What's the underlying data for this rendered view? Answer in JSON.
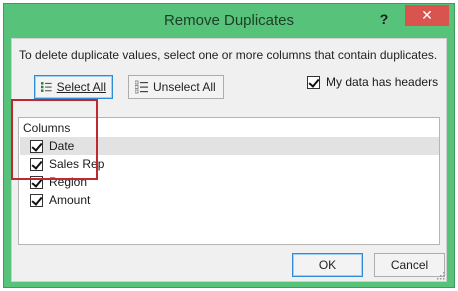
{
  "dialog": {
    "title": "Remove Duplicates",
    "help_label": "?",
    "close_label": "✕"
  },
  "instruction": "To delete duplicate values, select one or more columns that contain duplicates.",
  "buttons": {
    "select_all": {
      "label": "Select All",
      "mnemonic": "A",
      "icon": "checklist-icon"
    },
    "unselect_all": {
      "label": "Unselect All",
      "mnemonic": "U",
      "icon": "list-icon"
    },
    "ok": "OK",
    "cancel": "Cancel"
  },
  "headers_checkbox": {
    "label": "My data has headers",
    "checked": true
  },
  "columns": {
    "label": "Columns",
    "items": [
      {
        "label": "Date",
        "checked": true
      },
      {
        "label": "Sales Rep",
        "checked": true
      },
      {
        "label": "Region",
        "checked": true
      },
      {
        "label": "Amount",
        "checked": true
      }
    ]
  },
  "colors": {
    "title_bar": "#57c27a",
    "close_button": "#d9534f",
    "highlight_box": "#c0282f",
    "focus_border": "#2f8bd6"
  }
}
